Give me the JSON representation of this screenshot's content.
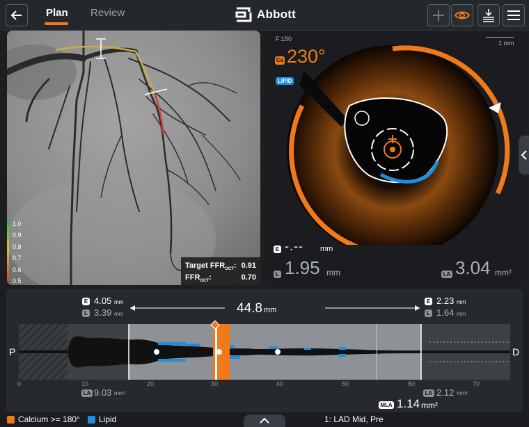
{
  "header": {
    "tabs": [
      {
        "label": "Plan",
        "active": true
      },
      {
        "label": "Review",
        "active": false
      }
    ],
    "logo_text": "Abbott",
    "toolbar": {
      "icons": [
        "back-arrow-icon",
        "plus-icon",
        "eye-icon",
        "download-tray-icon",
        "menu-icon"
      ]
    }
  },
  "colors": {
    "accent": "#f07a1a",
    "calcium": "#f07a1a",
    "lipid": "#1d8fe0"
  },
  "angiogram": {
    "ffr_scale": [
      "1.0",
      "0.9",
      "0.8",
      "0.7",
      "0.6",
      "0.5"
    ],
    "target_ffr_label": "Target FFR",
    "ffr_label": "FFR",
    "ffr_subscript": "OCT",
    "target_ffr_value": "0.91",
    "ffr_value": "0.70"
  },
  "oct": {
    "frame": "F:150",
    "scale_label": "1 mm",
    "calcium_badge": "Ca",
    "calcium_angle": "230°",
    "lipid_badge": "LIPID",
    "e_value": "-.--",
    "e_unit": "mm",
    "l_value": "1.95",
    "l_unit": "mm",
    "area_value": "3.04",
    "area_unit": "mm²"
  },
  "longitudinal": {
    "left_ref": {
      "e_value": "4.05",
      "l_value": "3.39",
      "unit": "mm",
      "area": "9.03",
      "area_unit": "mm²"
    },
    "right_ref": {
      "e_value": "2.23",
      "l_value": "1.64",
      "unit": "mm",
      "area": "2.12",
      "area_unit": "mm²"
    },
    "length": "44.8",
    "length_unit": "mm",
    "mla_label": "MLA",
    "mla_value": "1.14",
    "mla_unit": "mm²",
    "proximal_label": "P",
    "distal_label": "D",
    "ticks": [
      "0",
      "10",
      "20",
      "30",
      "40",
      "50",
      "60",
      "70"
    ],
    "badges": {
      "e": "E",
      "l": "L",
      "area": "LA"
    }
  },
  "footer": {
    "calcium_legend": "Calcium >= 180°",
    "lipid_legend": "Lipid",
    "location": "1:  LAD Mid, Pre",
    "handle_icon": "chevron-up-icon"
  }
}
